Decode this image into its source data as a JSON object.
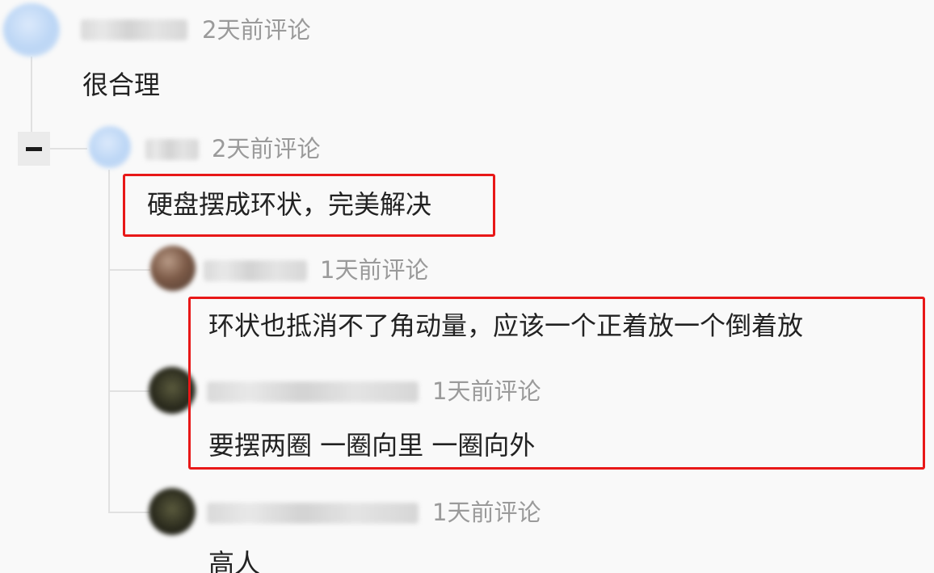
{
  "comments": [
    {
      "time": "2天前评论",
      "text": "很合理"
    },
    {
      "time": "2天前评论",
      "text": "硬盘摆成环状，完美解决"
    },
    {
      "time": "1天前评论",
      "text": "环状也抵消不了角动量，应该一个正着放一个倒着放"
    },
    {
      "time": "1天前评论",
      "text": "要摆两圈 一圈向里 一圈向外"
    },
    {
      "time": "1天前评论",
      "text": "高人"
    }
  ],
  "controls": {
    "collapse_icon": "minus-icon"
  },
  "colors": {
    "highlight": "#e81818",
    "meta_text": "#9a9a9a",
    "body_text": "#222222"
  }
}
